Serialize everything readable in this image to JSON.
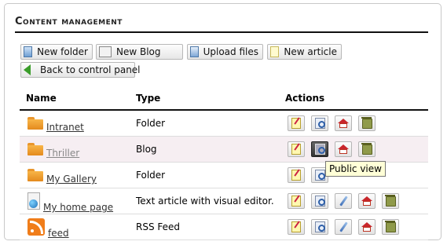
{
  "page_title": "Content management",
  "toolbar": {
    "new_folder": "New folder",
    "new_blog": "New Blog",
    "upload_files": "Upload files",
    "new_article": "New article",
    "back": "Back to control panel"
  },
  "table": {
    "headers": {
      "name": "Name",
      "type": "Type",
      "actions": "Actions"
    },
    "rows": [
      {
        "name": "Intranet",
        "type": "Folder",
        "icon": "folder-icon",
        "actions": [
          "edit",
          "preview",
          "home",
          "trash"
        ]
      },
      {
        "name": "Thriller",
        "type": "Blog",
        "icon": "folder-icon",
        "actions": [
          "edit",
          "preview",
          "home",
          "trash"
        ]
      },
      {
        "name": "My Gallery",
        "type": "Folder",
        "icon": "folder-icon",
        "actions": [
          "edit",
          "preview"
        ]
      },
      {
        "name": "My home page",
        "type": "Text article with visual editor.",
        "icon": "document-icon",
        "actions": [
          "edit",
          "preview",
          "link",
          "home",
          "trash"
        ]
      },
      {
        "name": "feed",
        "type": "RSS Feed",
        "icon": "rss-icon",
        "actions": [
          "edit",
          "preview",
          "link",
          "home",
          "trash"
        ]
      }
    ]
  },
  "tooltip": "Public view",
  "colors": {
    "alt_row": "#f6eef2",
    "tooltip_bg": "#ffffd7",
    "rss": "#f07d1a",
    "folder": "#f8b548"
  }
}
